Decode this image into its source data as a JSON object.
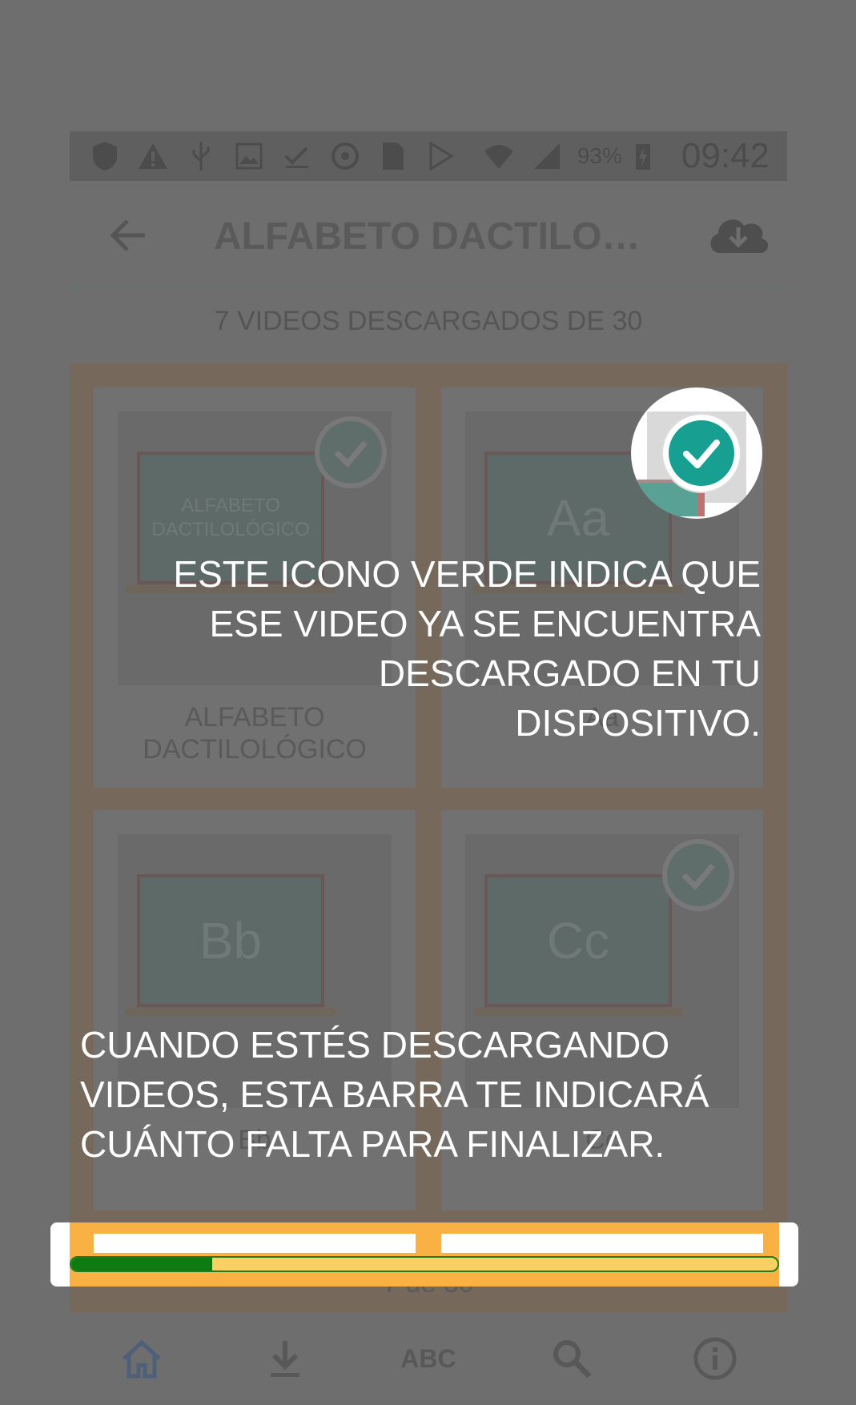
{
  "status_bar": {
    "battery_percent": "93%",
    "time": "09:42"
  },
  "header": {
    "title": "ALFABETO DACTILOLÓ...",
    "back_icon": "arrow-left-icon",
    "download_icon": "cloud-download-icon"
  },
  "summary": {
    "downloaded_text": "7 VIDEOS DESCARGADOS DE 30"
  },
  "cards": [
    {
      "label": "ALFABETO DACTILOLÓGICO",
      "board_text": "ALFABETO DACTILOLÓGICO",
      "downloaded": true
    },
    {
      "label": "Aa",
      "board_text": "Aa",
      "downloaded": true
    },
    {
      "label": "Bb",
      "board_text": "Bb",
      "downloaded": false
    },
    {
      "label": "Cc",
      "board_text": "Cc",
      "downloaded": true
    }
  ],
  "progress": {
    "caption": "7 de 30",
    "fraction": 0.2
  },
  "tutorial": {
    "tip_icon": "ESTE ICONO VERDE INDICA QUE ESE VIDEO YA SE ENCUENTRA DESCARGADO EN TU DISPOSITIVO.",
    "tip_icon_lines": [
      "ESTE ICONO VERDE INDICA QUE",
      "ESE VIDEO YA SE ENCUENTRA",
      "DESCARGADO EN TU DISPOSITIVO."
    ],
    "tip_bar_lines": [
      "CUANDO ESTÉS DESCARGANDO",
      "VIDEOS, ESTA BARRA TE INDICARÁ",
      "CUÁNTO FALTA PARA FINALIZAR."
    ]
  },
  "bottom_nav": {
    "abc_label": "ABC",
    "items": [
      "home-icon",
      "download-icon",
      "abc-icon",
      "search-icon",
      "info-icon"
    ]
  },
  "colors": {
    "overlay": "#6e6e6e",
    "check_green": "#17a092",
    "bar_green": "#0f7a10",
    "bar_orange": "#f9b143"
  }
}
